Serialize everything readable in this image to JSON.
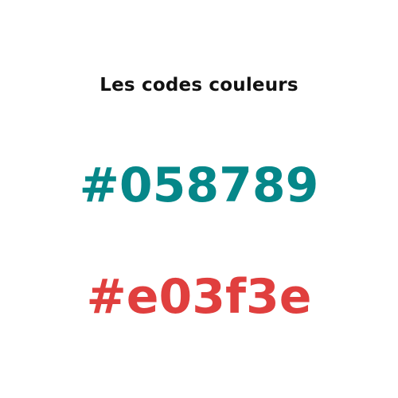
{
  "title": "Les codes couleurs",
  "codes": [
    {
      "label": "#058789",
      "color": "#058789"
    },
    {
      "label": "#e03f3e",
      "color": "#e03f3e"
    }
  ]
}
